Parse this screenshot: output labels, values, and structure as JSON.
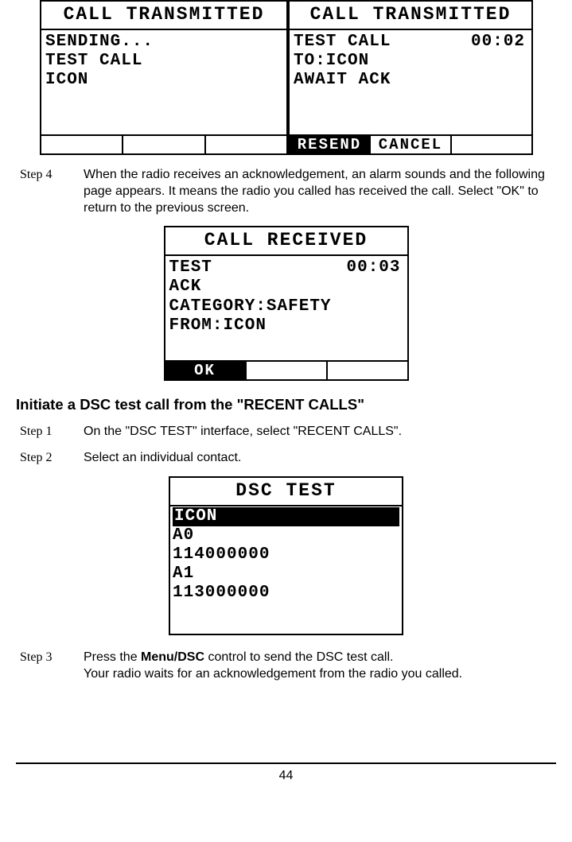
{
  "topLeft": {
    "title": "CALL TRANSMITTED",
    "line1": "SENDING...",
    "line2": "TEST CALL",
    "line3": "ICON"
  },
  "topRight": {
    "title": "CALL TRANSMITTED",
    "timer": "00:02",
    "line1": "TEST CALL",
    "line2": "TO:ICON",
    "line3": "AWAIT ACK",
    "btn1": "RESEND",
    "btn2": "CANCEL"
  },
  "step4": {
    "label": "Step 4",
    "text": "When the radio receives an acknowledgement, an alarm sounds and the following page appears. It means the radio you called has received the call. Select \"OK\" to return to the previous screen."
  },
  "midScreen": {
    "title": "CALL RECEIVED",
    "timer": "00:03",
    "line1": "TEST",
    "line2": "ACK",
    "line3": "CATEGORY:SAFETY",
    "line4": "FROM:ICON",
    "btn1": "OK"
  },
  "sectionHeader": "Initiate a DSC test call from the \"RECENT CALLS\"",
  "step1": {
    "label": "Step 1",
    "text": "On the \"DSC TEST\" interface, select \"RECENT CALLS\"."
  },
  "step2": {
    "label": "Step 2",
    "text": "Select an individual contact."
  },
  "listScreen": {
    "title": "DSC TEST",
    "item1": "ICON",
    "item2": "A0",
    "item3": "114000000",
    "item4": "A1",
    "item5": "113000000"
  },
  "step3": {
    "label": "Step 3",
    "textPrefix": "Press the ",
    "boldPart": "Menu/DSC",
    "textMid": " control to send the DSC test call.",
    "text2": "Your radio waits for an acknowledgement from the radio you called."
  },
  "pageNumber": "44"
}
